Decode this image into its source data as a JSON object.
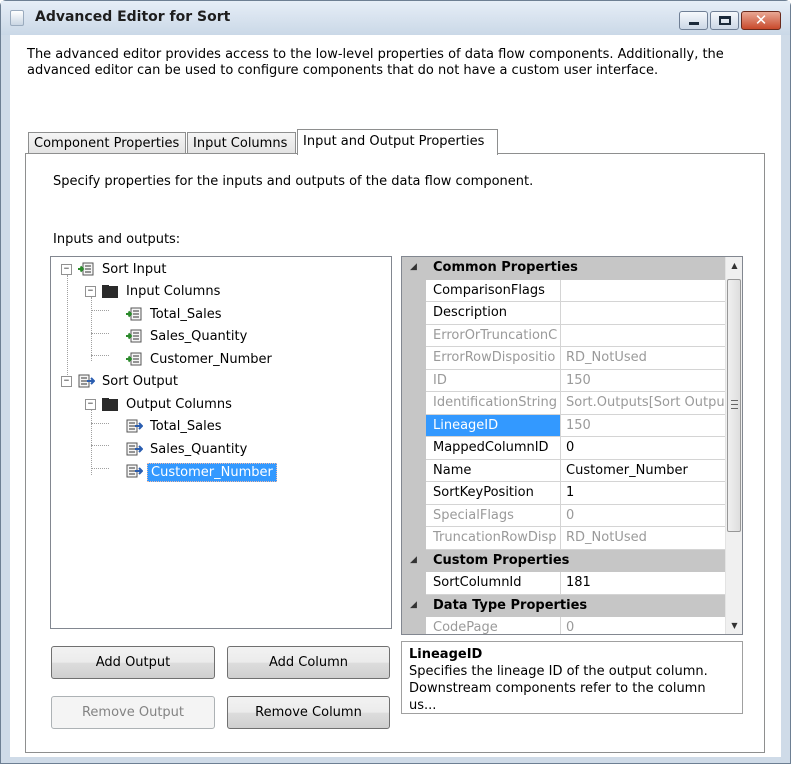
{
  "window": {
    "title": "Advanced Editor for Sort",
    "close_glyph": "✕"
  },
  "description": "The advanced editor provides access to the low-level properties of data flow components. Additionally, the advanced editor can be used to configure components that do not have a custom user interface.",
  "tabs": [
    {
      "label": "Component Properties"
    },
    {
      "label": "Input Columns"
    },
    {
      "label": "Input and Output Properties",
      "active": true
    }
  ],
  "panel": {
    "description": "Specify properties for the inputs and outputs of the data flow component.",
    "io_label": "Inputs and outputs:"
  },
  "tree": {
    "nodes": [
      {
        "label": "Sort Input",
        "expander": "−",
        "icon": "input-icon"
      },
      {
        "label": "Input Columns",
        "expander": "−",
        "icon": "folder-icon"
      },
      {
        "label": "Total_Sales",
        "icon": "input-column-icon"
      },
      {
        "label": "Sales_Quantity",
        "icon": "input-column-icon"
      },
      {
        "label": "Customer_Number",
        "icon": "input-column-icon"
      },
      {
        "label": "Sort Output",
        "expander": "−",
        "icon": "output-icon"
      },
      {
        "label": "Output Columns",
        "expander": "−",
        "icon": "folder-icon"
      },
      {
        "label": "Total_Sales",
        "icon": "output-column-icon"
      },
      {
        "label": "Sales_Quantity",
        "icon": "output-column-icon"
      },
      {
        "label": "Customer_Number",
        "icon": "output-column-icon",
        "selected": true
      }
    ]
  },
  "buttons": {
    "add_output": "Add Output",
    "add_column": "Add Column",
    "remove_output": "Remove Output",
    "remove_column": "Remove Column"
  },
  "grid": {
    "categories": {
      "common": "Common Properties",
      "custom": "Custom Properties",
      "datatype": "Data Type Properties"
    },
    "rows": [
      {
        "name": "ComparisonFlags",
        "value": ""
      },
      {
        "name": "Description",
        "value": ""
      },
      {
        "name": "ErrorOrTruncationC",
        "value": "",
        "readonly": true
      },
      {
        "name": "ErrorRowDispositio",
        "value": "RD_NotUsed",
        "readonly": true
      },
      {
        "name": "ID",
        "value": "150",
        "readonly": true
      },
      {
        "name": "IdentificationString",
        "value": "Sort.Outputs[Sort Outpu",
        "readonly": true
      },
      {
        "name": "LineageID",
        "value": "150",
        "readonly": true,
        "selected": true
      },
      {
        "name": "MappedColumnID",
        "value": "0"
      },
      {
        "name": "Name",
        "value": "Customer_Number"
      },
      {
        "name": "SortKeyPosition",
        "value": "1"
      },
      {
        "name": "SpecialFlags",
        "value": "0",
        "readonly": true
      },
      {
        "name": "TruncationRowDisp",
        "value": "RD_NotUsed",
        "readonly": true
      },
      {
        "name": "SortColumnId",
        "value": "181"
      },
      {
        "name": "CodePage",
        "value": "0",
        "readonly": true
      }
    ]
  },
  "help": {
    "title": "LineageID",
    "text": "Specifies the lineage ID of the output column. Downstream components refer to the column us..."
  }
}
